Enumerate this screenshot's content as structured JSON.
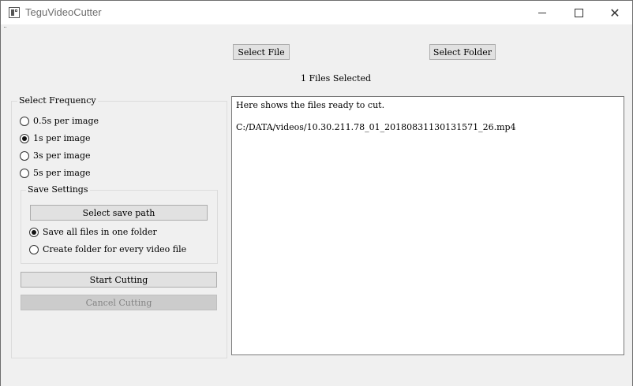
{
  "window": {
    "title": "TeguVideoCutter",
    "minimize_glyph": "",
    "maximize_glyph": "",
    "close_glyph": "✕"
  },
  "toolbar": {
    "select_file_label": "Select File",
    "select_folder_label": "Select Folder",
    "files_selected_text": "1 Files Selected"
  },
  "frequency": {
    "title": "Select Frequency",
    "options": [
      {
        "label": "0.5s per image",
        "checked": false
      },
      {
        "label": "1s per image",
        "checked": true
      },
      {
        "label": "3s per image",
        "checked": false
      },
      {
        "label": "5s per image",
        "checked": false
      }
    ]
  },
  "save_settings": {
    "title": "Save Settings",
    "select_path_label": "Select save path",
    "options": [
      {
        "label": "Save all files in one folder",
        "checked": true
      },
      {
        "label": "Create folder for every video file",
        "checked": false
      }
    ]
  },
  "actions": {
    "start_label": "Start Cutting",
    "cancel_label": "Cancel Cutting",
    "cancel_enabled": false
  },
  "file_list": {
    "header": "Here shows the files ready to cut.",
    "files": [
      "C:/DATA/videos/10.30.211.78_01_20180831130131571_26.mp4"
    ]
  },
  "icons": {
    "app": "film-app-icon",
    "minimize": "minimize-icon",
    "maximize": "maximize-icon",
    "close": "close-icon"
  },
  "colors": {
    "background": "#f0f0f0",
    "button": "#e1e1e1",
    "button_disabled": "#cccccc",
    "text_disabled": "#838383"
  }
}
